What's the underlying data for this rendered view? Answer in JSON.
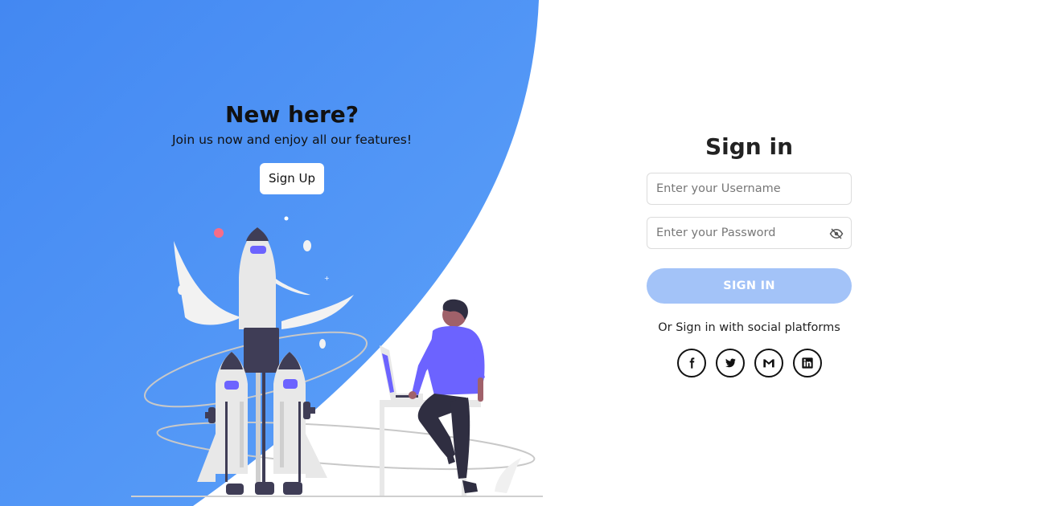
{
  "left_panel": {
    "title": "New here?",
    "subtitle": "Join us now and enjoy all our features!",
    "signup_label": "Sign Up"
  },
  "right_panel": {
    "title": "Sign in",
    "username_placeholder": "Enter your Username",
    "password_placeholder": "Enter your Password",
    "signin_label": "SIGN IN",
    "social_text": "Or Sign in with social platforms",
    "social_icons": [
      "facebook-icon",
      "twitter-icon",
      "gmail-icon",
      "linkedin-icon"
    ]
  },
  "colors": {
    "blue_panel": "#4d8ef5",
    "signin_button": "#a3c3f8",
    "accent_purple": "#6c63ff"
  }
}
